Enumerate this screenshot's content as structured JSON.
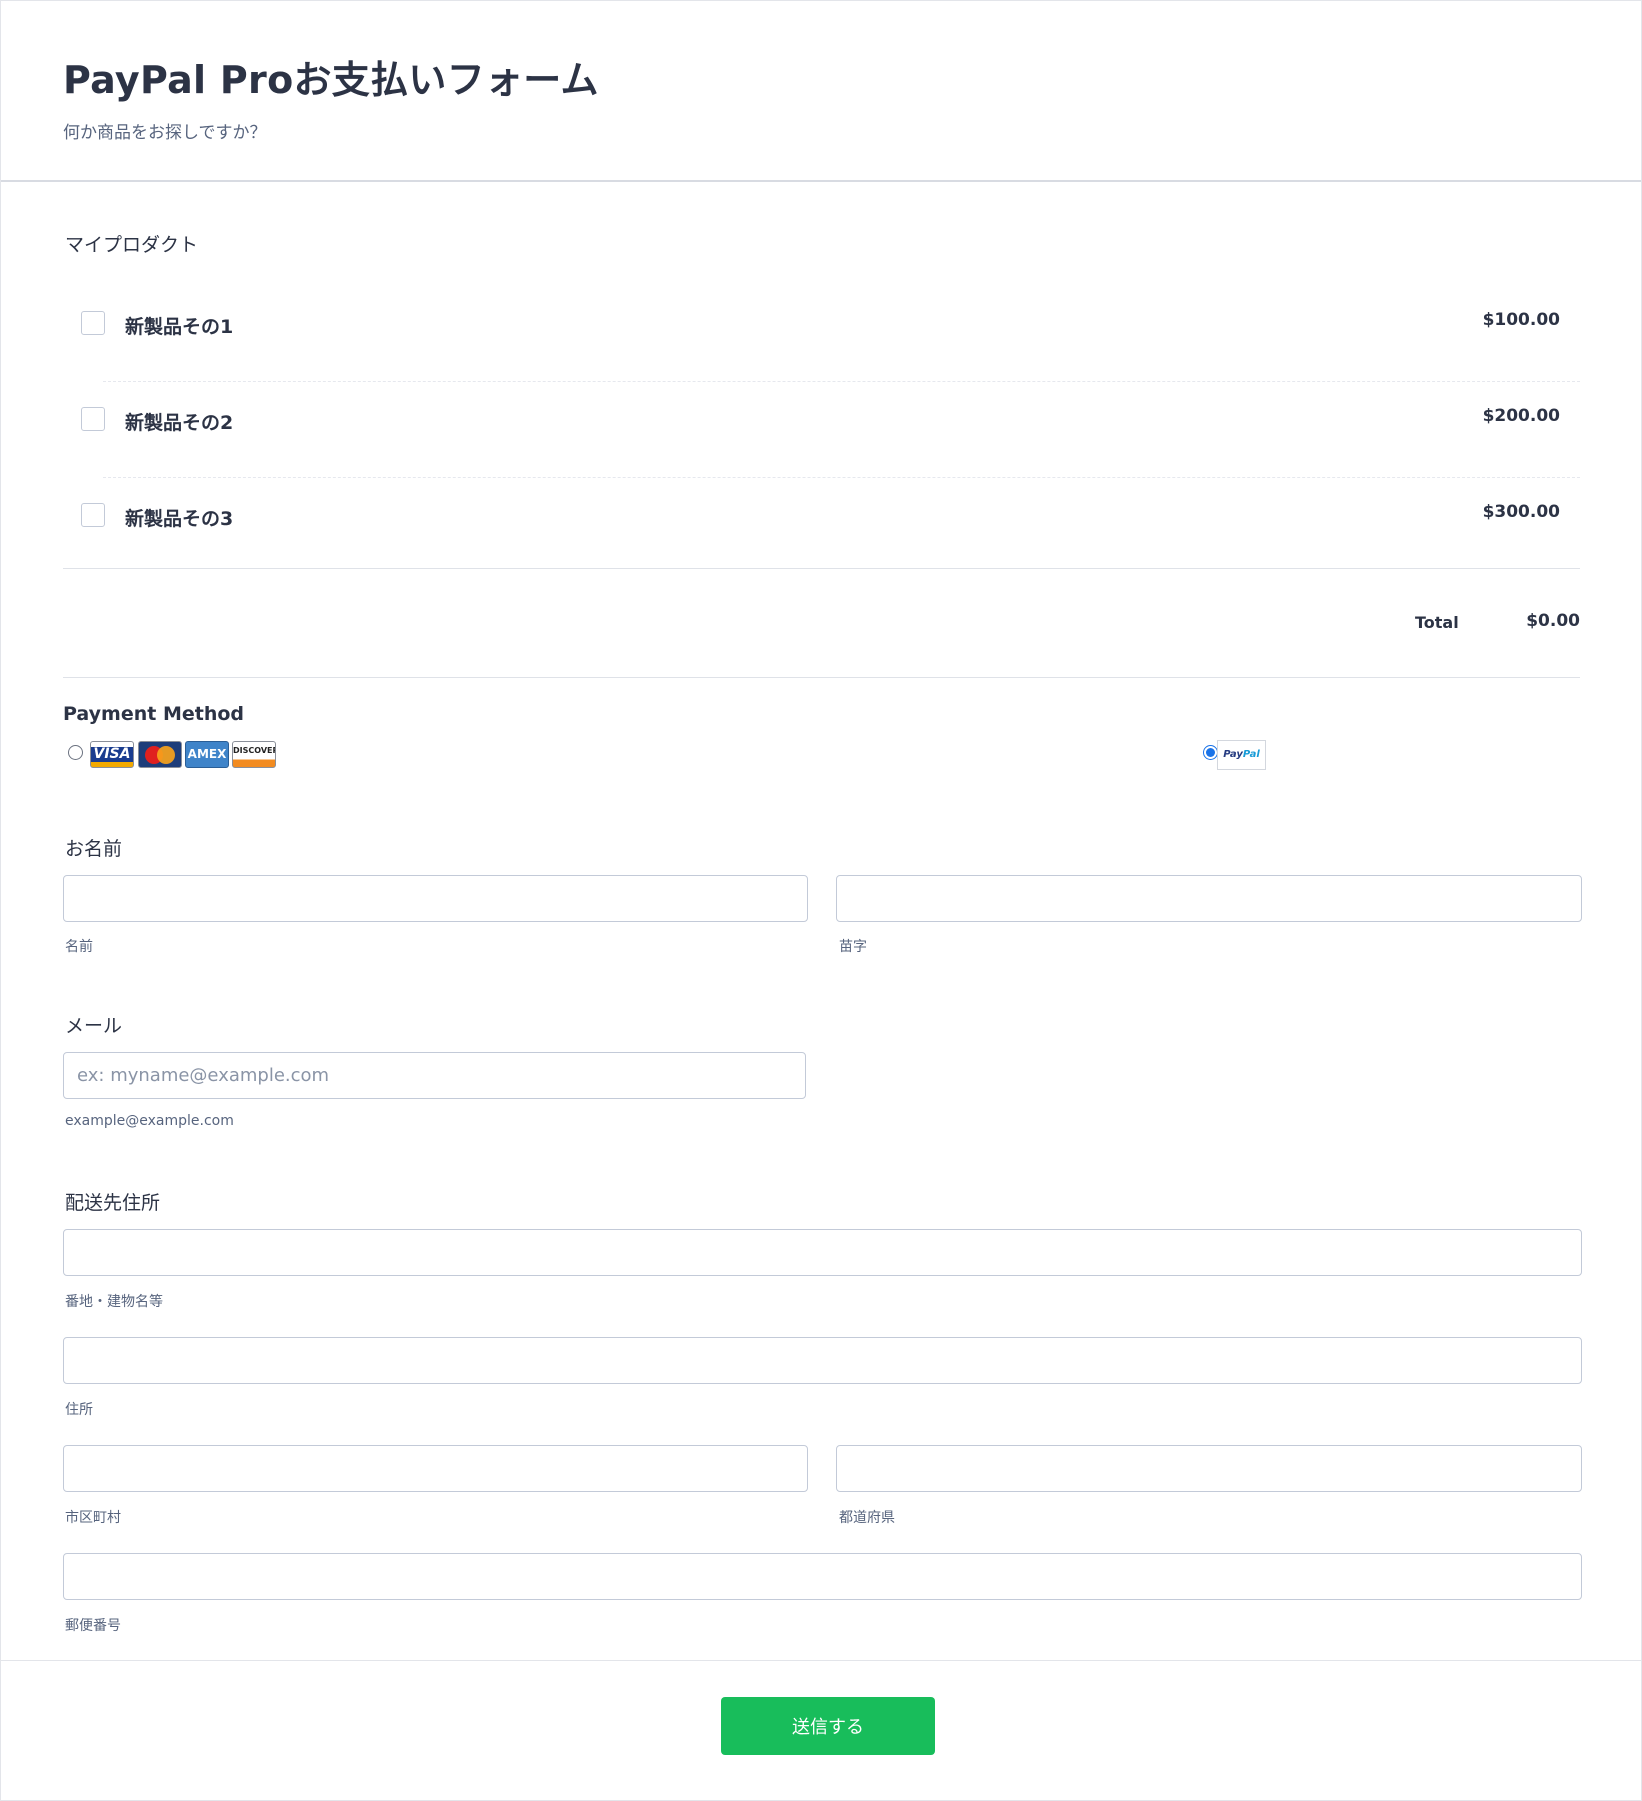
{
  "header": {
    "title": "PayPal Proお支払いフォーム",
    "subtitle": "何か商品をお探しですか？"
  },
  "products": {
    "label": "マイプロダクト",
    "items": [
      {
        "name": "新製品その1",
        "price": "$100.00",
        "checked": false
      },
      {
        "name": "新製品その2",
        "price": "$200.00",
        "checked": false
      },
      {
        "name": "新製品その3",
        "price": "$300.00",
        "checked": false
      }
    ],
    "total_label": "Total",
    "total_value": "$0.00"
  },
  "payment": {
    "title": "Payment Method",
    "options": [
      {
        "id": "credit-card",
        "cards": [
          "VISA",
          "MasterCard",
          "AMEX",
          "DISCOVER"
        ],
        "selected": false
      },
      {
        "id": "paypal",
        "logo_text": [
          "Pay",
          "Pal"
        ],
        "selected": true
      }
    ]
  },
  "name_field": {
    "label": "お名前",
    "first_value": "",
    "first_sublabel": "名前",
    "last_value": "",
    "last_sublabel": "苗字"
  },
  "email_field": {
    "label": "メール",
    "value": "",
    "placeholder": "ex: myname@example.com",
    "sublabel": "example@example.com"
  },
  "address_field": {
    "label": "配送先住所",
    "line1_sublabel": "番地・建物名等",
    "line2_sublabel": "住所",
    "city_sublabel": "市区町村",
    "state_sublabel": "都道府県",
    "postal_sublabel": "郵便番号"
  },
  "submit": {
    "label": "送信する",
    "color": "#18bd5b"
  },
  "colors": {
    "text": "#2c3345",
    "muted": "#57647e",
    "accent": "#1a73e8"
  }
}
